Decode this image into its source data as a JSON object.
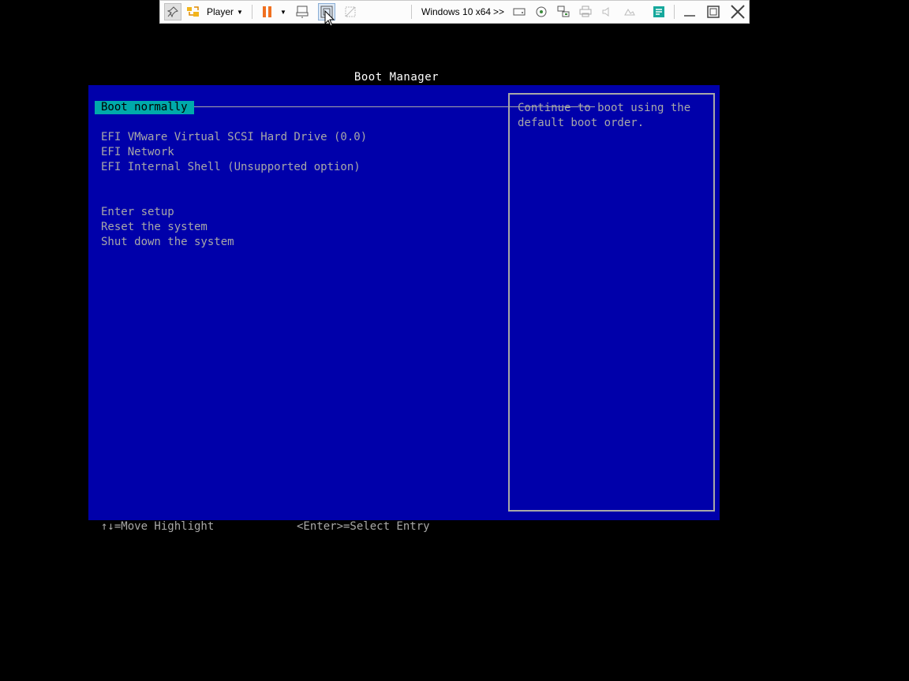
{
  "toolbar": {
    "player_label": "Player",
    "vm_name": "Windows 10 x64",
    "overflow": ">>",
    "icons": [
      "pin-icon",
      "library-icon",
      "pause-icon",
      "send-ctrl-alt-del-icon",
      "fit-guest-icon",
      "unity-icon",
      "hard-disk-icon",
      "cd-dvd-icon",
      "network-adapter-icon",
      "printer-icon",
      "sound-icon",
      "usb-icon",
      "message-log-icon",
      "minimize-icon",
      "restore-icon",
      "close-icon"
    ],
    "accent_pause": "#f07020",
    "accent_msg": "#16a89c"
  },
  "bios": {
    "title": "Boot Manager",
    "selected": "Boot normally",
    "boot_options": [
      "EFI VMware Virtual SCSI Hard Drive (0.0)",
      "EFI Network",
      "EFI Internal Shell (Unsupported option)"
    ],
    "system_options": [
      "Enter setup",
      "Reset the system",
      "Shut down the system"
    ],
    "help_text": "Continue to boot using the default boot order.",
    "footer_left": "↑↓=Move Highlight",
    "footer_right": "<Enter>=Select Entry",
    "colors": {
      "background": "#0000aa",
      "highlight": "#00aaaa",
      "text": "#a8a8a8"
    }
  }
}
